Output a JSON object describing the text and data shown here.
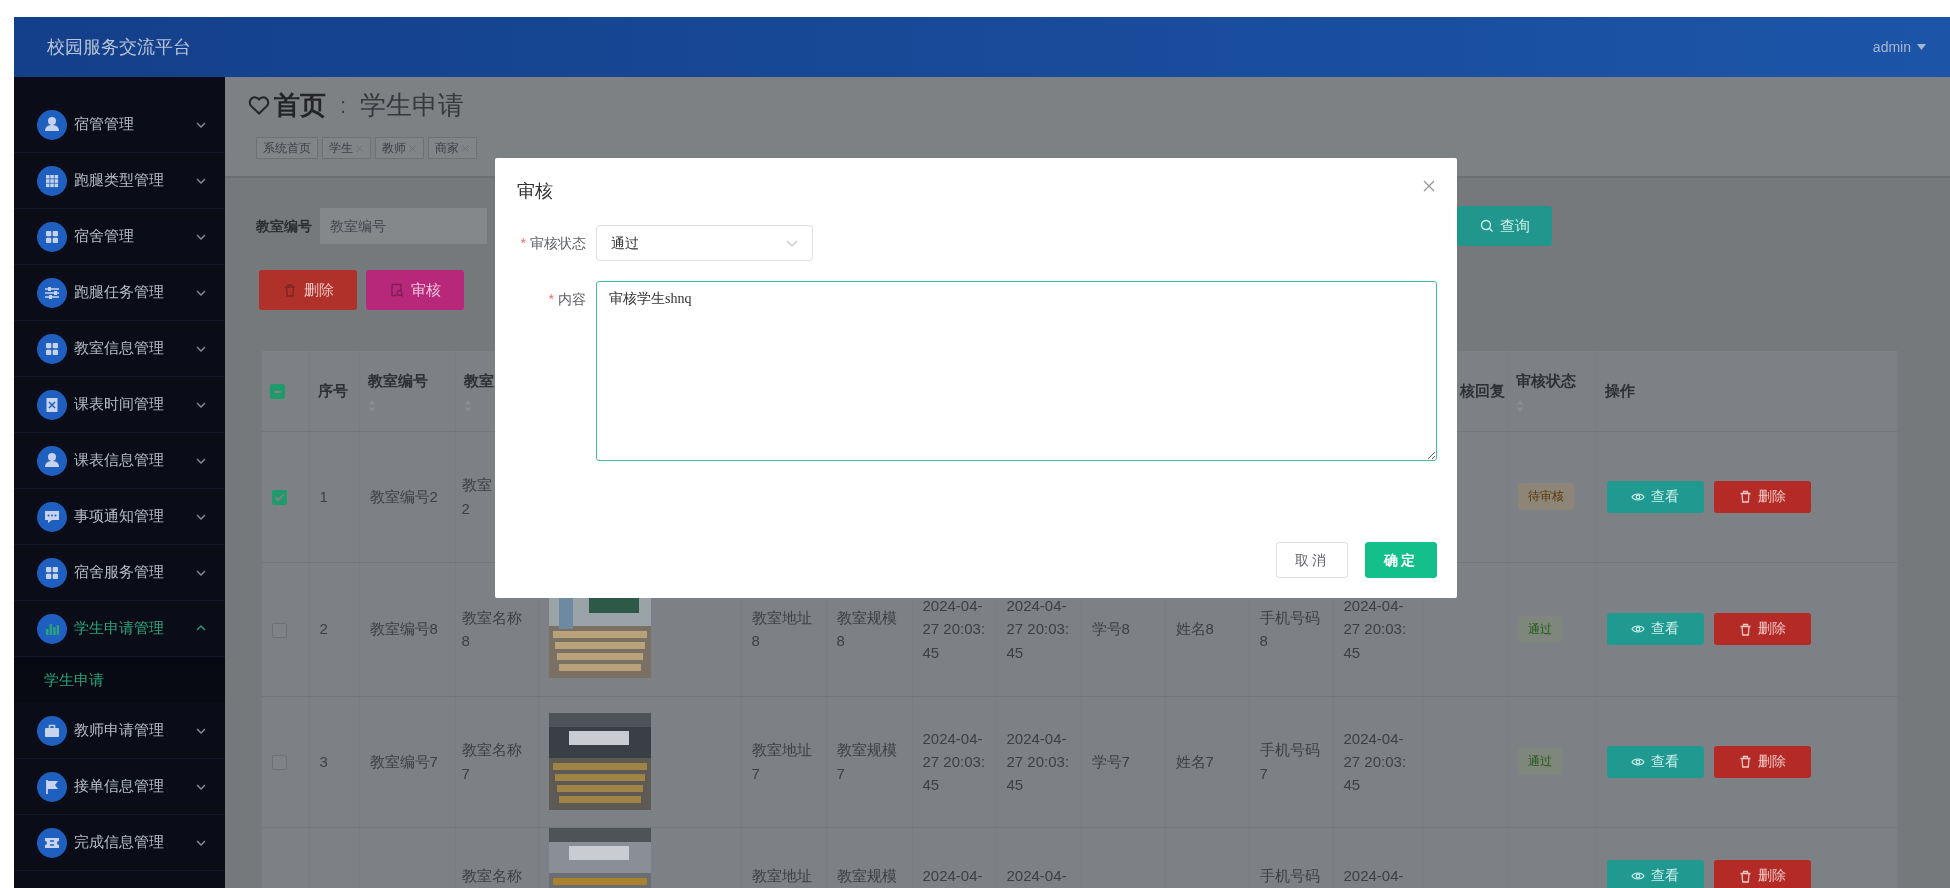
{
  "header": {
    "title": "校园服务交流平台",
    "user": "admin"
  },
  "sidebar": {
    "items": [
      {
        "label": "宿管管理",
        "expanded": false
      },
      {
        "label": "跑腿类型管理",
        "expanded": false
      },
      {
        "label": "宿舍管理",
        "expanded": false
      },
      {
        "label": "跑腿任务管理",
        "expanded": false
      },
      {
        "label": "教室信息管理",
        "expanded": false
      },
      {
        "label": "课表时间管理",
        "expanded": false
      },
      {
        "label": "课表信息管理",
        "expanded": false
      },
      {
        "label": "事项通知管理",
        "expanded": false
      },
      {
        "label": "宿舍服务管理",
        "expanded": false
      },
      {
        "label": "学生申请管理",
        "expanded": true,
        "children": [
          {
            "label": "学生申请",
            "selected": true
          }
        ]
      },
      {
        "label": "教师申请管理",
        "expanded": false
      },
      {
        "label": "接单信息管理",
        "expanded": false
      },
      {
        "label": "完成信息管理",
        "expanded": false
      }
    ]
  },
  "breadcrumb": {
    "home": "首页",
    "separator": ":",
    "current": "学生申请"
  },
  "tags": [
    {
      "label": "系统首页",
      "closable": false
    },
    {
      "label": "学生",
      "closable": true
    },
    {
      "label": "教师",
      "closable": true
    },
    {
      "label": "商家",
      "closable": true
    }
  ],
  "search": {
    "label": "教室编号",
    "placeholder": "教室编号",
    "button": "查询"
  },
  "actions": [
    {
      "label": "删除",
      "kind": "delete"
    },
    {
      "label": "审核",
      "kind": "review"
    }
  ],
  "table": {
    "header_checkbox": {
      "indeterminate": true
    },
    "columns": [
      {
        "label": "序号",
        "sortable": false
      },
      {
        "label": "教室编号",
        "sortable": true
      },
      {
        "label": "教室",
        "sortable": true
      },
      null,
      null,
      null,
      null,
      null,
      null,
      null,
      null,
      null,
      {
        "label": "核回复",
        "sortable": false
      },
      {
        "label": "审核状态",
        "sortable": true
      },
      {
        "label": "操作",
        "sortable": false
      }
    ],
    "rows": [
      {
        "checked": true,
        "cells": [
          "1",
          "教室编号2",
          "教室\n2",
          null,
          null,
          null,
          null,
          null,
          null,
          null,
          null,
          null,
          null
        ],
        "status": {
          "label": "待审核",
          "kind": "pending"
        },
        "actions": [
          "查看",
          "删除"
        ]
      },
      {
        "checked": false,
        "cells": [
          "2",
          "教室编号8",
          "教室名称8",
          {
            "kind": "picture"
          },
          "教室地址8",
          "教室规模8",
          "2024-04-27 20:03:45",
          "2024-04-27 20:03:45",
          "学号8",
          "姓名8",
          "手机号码8",
          "2024-04-27 20:03:45",
          null
        ],
        "status": {
          "label": "通过",
          "kind": "passed"
        },
        "actions": [
          "查看",
          "删除"
        ]
      },
      {
        "checked": false,
        "cells": [
          "3",
          "教室编号7",
          "教室名称7",
          {
            "kind": "picture"
          },
          "教室地址7",
          "教室规模7",
          "2024-04-27 20:03:45",
          "2024-04-27 20:03:45",
          "学号7",
          "姓名7",
          "手机号码7",
          "2024-04-27 20:03:45",
          null
        ],
        "status": {
          "label": "通过",
          "kind": "passed"
        },
        "actions": [
          "查看",
          "删除"
        ]
      },
      {
        "cells": [
          null,
          null,
          "教室名称",
          {
            "kind": "picture"
          },
          "教室地址",
          "教室规模",
          "2024-04-",
          "2024-04-",
          null,
          null,
          "手机号码",
          "2024-04-",
          null
        ],
        "actions": [
          "查看",
          "删除"
        ]
      }
    ]
  },
  "modal": {
    "title": "审核",
    "fields": [
      {
        "mark": "*",
        "label": "审核状态",
        "kind": "select",
        "value": "通过"
      },
      {
        "mark": "*",
        "label": "内容",
        "kind": "textarea",
        "value": "审核学生shnq",
        "focused": true
      }
    ],
    "buttons": [
      {
        "label": "取消",
        "kind": "default"
      },
      {
        "label": "确定",
        "kind": "primary"
      }
    ]
  }
}
